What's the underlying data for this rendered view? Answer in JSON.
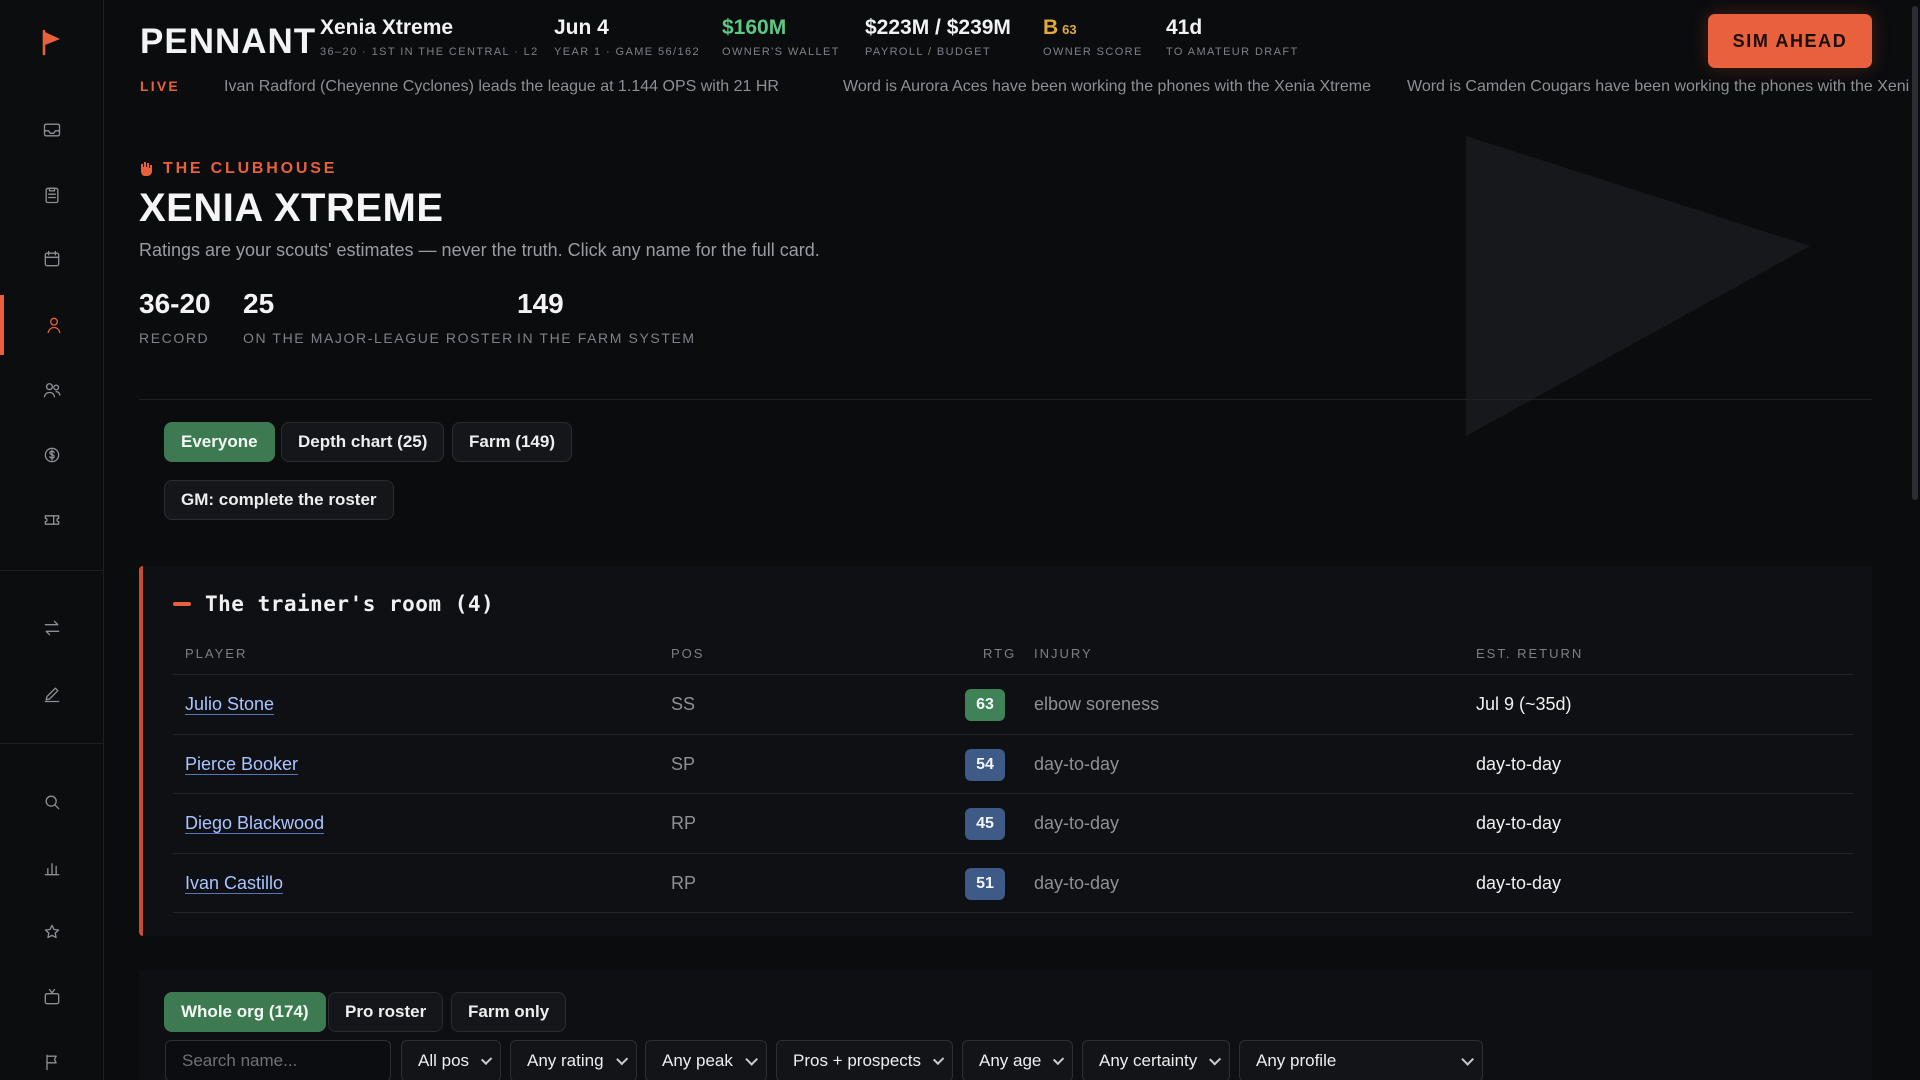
{
  "brand": "PENNANT",
  "header": {
    "team": {
      "value": "Xenia Xtreme",
      "label": "36–20 · 1st in the Central · L2"
    },
    "date": {
      "value": "Jun 4",
      "label": "Year 1 · Game 56/162"
    },
    "wallet": {
      "value": "$160M",
      "label": "Owner's wallet"
    },
    "payroll": {
      "value": "$223M / $239M",
      "label": "Payroll / Budget"
    },
    "owner_score": {
      "grade": "B",
      "score": "63",
      "label": "Owner score"
    },
    "draft": {
      "value": "41d",
      "label": "To amateur draft"
    },
    "sim_button": "SIM AHEAD"
  },
  "ticker": {
    "live": "LIVE",
    "messages": [
      "Ivan Radford (Cheyenne Cyclones) leads the league at 1.144 OPS with 21 HR",
      "Word is Aurora Aces have been working the phones with the Xenia Xtreme",
      "Word is Camden Cougars have been working the phones with the Xenia Xtreme"
    ]
  },
  "page": {
    "eyebrow": "THE CLUBHOUSE",
    "title": "XENIA XTREME",
    "subtitle": "Ratings are your scouts' estimates — never the truth. Click any name for the full card.",
    "kpis": [
      {
        "value": "36-20",
        "label": "Record"
      },
      {
        "value": "25",
        "label": "On the major-league roster"
      },
      {
        "value": "149",
        "label": "In the farm system"
      }
    ],
    "view_chips": [
      "Everyone",
      "Depth chart (25)",
      "Farm (149)"
    ],
    "gm_chip": "GM: complete the roster"
  },
  "trainer": {
    "title": "The trainer's room (4)",
    "headers": {
      "player": "Player",
      "pos": "Pos",
      "rtg": "Rtg",
      "injury": "Injury",
      "return": "Est. Return"
    },
    "rows": [
      {
        "player": "Julio Stone",
        "pos": "SS",
        "rtg": "63",
        "injury": "elbow soreness",
        "return": "Jul 9 (~35d)"
      },
      {
        "player": "Pierce Booker",
        "pos": "SP",
        "rtg": "54",
        "injury": "day-to-day",
        "return": "day-to-day"
      },
      {
        "player": "Diego Blackwood",
        "pos": "RP",
        "rtg": "45",
        "injury": "day-to-day",
        "return": "day-to-day"
      },
      {
        "player": "Ivan Castillo",
        "pos": "RP",
        "rtg": "51",
        "injury": "day-to-day",
        "return": "day-to-day"
      }
    ]
  },
  "filters": {
    "scope_chips": [
      "Whole org (174)",
      "Pro roster",
      "Farm only"
    ],
    "search_placeholder": "Search name...",
    "selects": [
      "All pos",
      "Any rating",
      "Any peak",
      "Pros + prospects",
      "Any age",
      "Any certainty",
      "Any profile"
    ]
  },
  "colors": {
    "accent": "#e8613c",
    "positive": "#3f8257",
    "rating_blue": "#3e5a86",
    "wallet": "#5cc884",
    "grade": "#e0a93a"
  },
  "sidebar_icons": [
    "flag-icon",
    "inbox-icon",
    "clipboard-icon",
    "calendar-icon",
    "person-icon",
    "people-icon",
    "dollar-icon",
    "ticket-icon",
    "swap-icon",
    "pencil-icon",
    "search-icon",
    "bar-chart-icon",
    "star-icon",
    "tv-icon",
    "flag-outline-icon"
  ]
}
